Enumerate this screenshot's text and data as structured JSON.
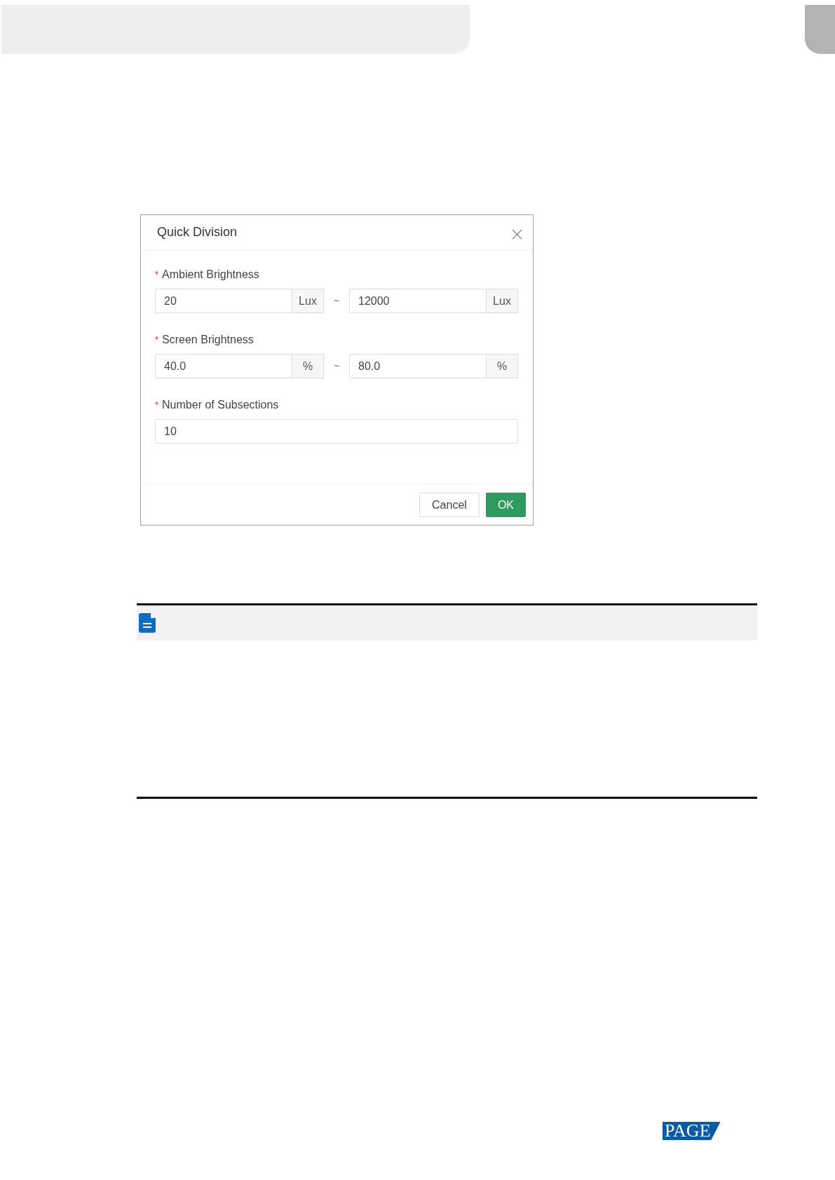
{
  "dialog": {
    "title": "Quick Division",
    "fields": [
      {
        "kind": "range",
        "mark": "*",
        "label": "Ambient Brightness",
        "from": "20",
        "from_unit": "Lux",
        "to": "12000",
        "to_unit": "Lux"
      },
      {
        "kind": "range",
        "mark": "*",
        "label": "Screen Brightness",
        "from": "40.0",
        "from_unit": "%",
        "to": "80.0",
        "to_unit": "%"
      },
      {
        "kind": "single",
        "mark": "*",
        "label": "Number of Subsections",
        "value": "10"
      }
    ],
    "separators": [
      "~",
      "~"
    ],
    "buttons": [
      {
        "label": "Cancel",
        "kind": "secondary"
      },
      {
        "label": "OK",
        "kind": "primary"
      }
    ]
  },
  "footer": {
    "logo": "PAGE"
  }
}
